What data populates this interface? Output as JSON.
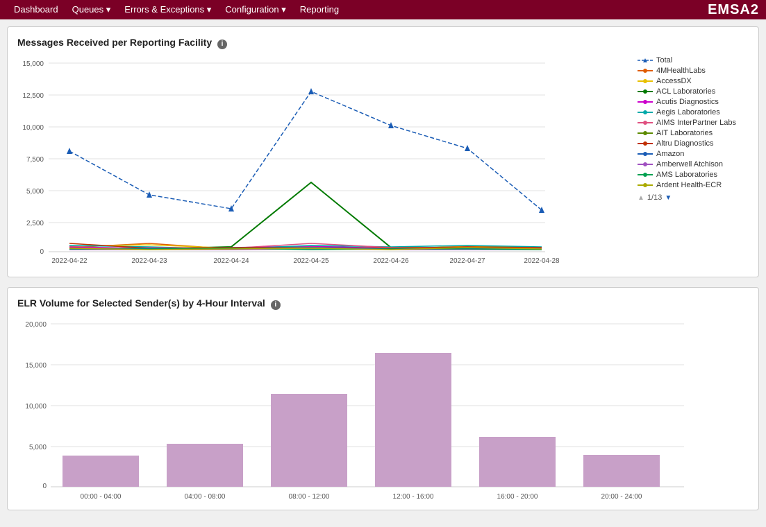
{
  "navbar": {
    "items": [
      {
        "label": "Dashboard",
        "has_dropdown": false
      },
      {
        "label": "Queues",
        "has_dropdown": true
      },
      {
        "label": "Errors & Exceptions",
        "has_dropdown": true
      },
      {
        "label": "Configuration",
        "has_dropdown": true
      },
      {
        "label": "Reporting",
        "has_dropdown": false
      }
    ],
    "brand": "EMSA2"
  },
  "chart1": {
    "title": "Messages Received per Reporting Facility",
    "yAxis": {
      "max": 15000,
      "ticks": [
        0,
        2500,
        5000,
        7500,
        10000,
        12500,
        15000
      ]
    },
    "xAxis": {
      "labels": [
        "2022-04-22",
        "2022-04-23",
        "2022-04-24",
        "2022-04-25",
        "2022-04-26",
        "2022-04-27",
        "2022-04-28"
      ]
    },
    "legend": {
      "items": [
        {
          "label": "Total",
          "color": "#1a5cb5",
          "style": "dashed"
        },
        {
          "label": "4MHealthLabs",
          "color": "#e05c00"
        },
        {
          "label": "AccessDX",
          "color": "#e8c000"
        },
        {
          "label": "ACL Laboratories",
          "color": "#007a00"
        },
        {
          "label": "Acutis Diagnostics",
          "color": "#cc00cc"
        },
        {
          "label": "Aegis Laboratories",
          "color": "#00aaaa"
        },
        {
          "label": "AIMS InterPartner Labs",
          "color": "#e05080"
        },
        {
          "label": "AIT Laboratories",
          "color": "#5c8a00"
        },
        {
          "label": "Altru Diagnostics",
          "color": "#c03000"
        },
        {
          "label": "Amazon",
          "color": "#1a5cb5"
        },
        {
          "label": "Amberwell Atchison",
          "color": "#a050c0"
        },
        {
          "label": "AMS Laboratories",
          "color": "#00a050"
        },
        {
          "label": "Ardent Health-ECR",
          "color": "#aaaa00"
        }
      ],
      "pagination": "1/13"
    }
  },
  "chart2": {
    "title": "ELR Volume for Selected Sender(s) by 4-Hour Interval",
    "yAxis": {
      "max": 20000,
      "ticks": [
        0,
        5000,
        10000,
        15000,
        20000
      ]
    },
    "bars": [
      {
        "label": "00:00 - 04:00",
        "value": 3800
      },
      {
        "label": "04:00 - 08:00",
        "value": 5300
      },
      {
        "label": "08:00 - 12:00",
        "value": 11400
      },
      {
        "label": "12:00 - 16:00",
        "value": 16400
      },
      {
        "label": "16:00 - 20:00",
        "value": 6100
      },
      {
        "label": "20:00 - 24:00",
        "value": 3900
      }
    ]
  }
}
